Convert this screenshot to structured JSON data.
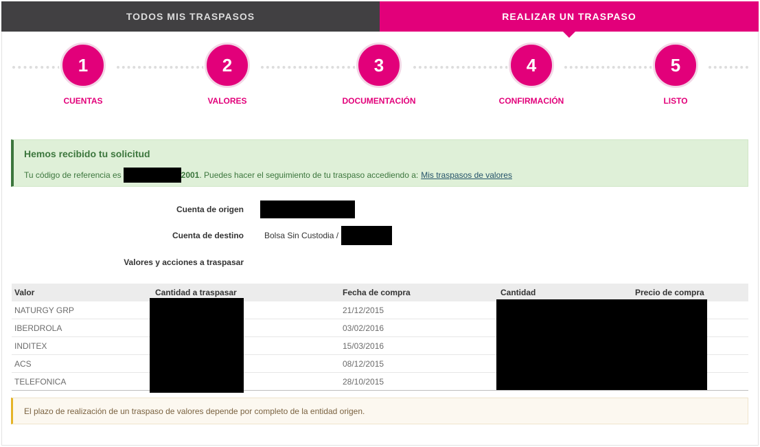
{
  "tabs": {
    "left_label": "TODOS MIS TRASPASOS",
    "right_label": "REALIZAR UN TRASPASO"
  },
  "steps": [
    {
      "number": "1",
      "label": "CUENTAS"
    },
    {
      "number": "2",
      "label": "VALORES"
    },
    {
      "number": "3",
      "label": "DOCUMENTACIÓN"
    },
    {
      "number": "4",
      "label": "CONFIRMACIÓN"
    },
    {
      "number": "5",
      "label": "LISTO"
    }
  ],
  "success": {
    "title": "Hemos recibido tu solicitud",
    "prefix": "Tu código de referencia es",
    "code_suffix": "2001",
    "middle": ". Puedes hacer el seguimiento de tu traspaso accediendo a:",
    "link": "Mis traspasos de valores"
  },
  "summary": {
    "origin_label": "Cuenta de origen",
    "destination_label": "Cuenta de destino",
    "destination_value": "Bolsa Sin Custodia /",
    "securities_label": "Valores y acciones a traspasar"
  },
  "table": {
    "headers": [
      "Valor",
      "Cantidad a traspasar",
      "Fecha de compra",
      "Cantidad",
      "Precio de compra"
    ],
    "rows": [
      {
        "valor": "NATURGY GRP",
        "fecha": "21/12/2015"
      },
      {
        "valor": "IBERDROLA",
        "fecha": "03/02/2016"
      },
      {
        "valor": "INDITEX",
        "fecha": "15/03/2016"
      },
      {
        "valor": "ACS",
        "fecha": "08/12/2015"
      },
      {
        "valor": "TELEFONICA",
        "fecha": "28/10/2015"
      }
    ]
  },
  "warning": {
    "text": "El plazo de realización de un traspaso de valores depende por completo de la entidad origen."
  },
  "colors": {
    "brand": "#e2007a",
    "tab_dark": "#414042",
    "success_bg": "#dff0d8",
    "warning_bg": "#fcf8f0"
  }
}
